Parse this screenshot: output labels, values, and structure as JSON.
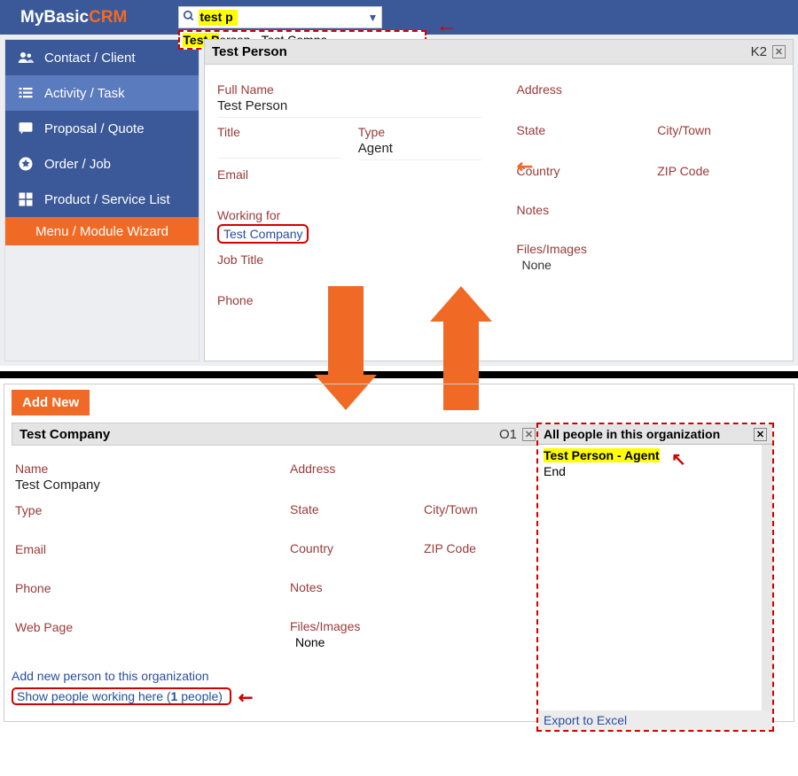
{
  "brand": {
    "part1": "MyBasic",
    "part2": "CRM"
  },
  "search": {
    "value": "test p",
    "suggestion_prefix": "Test P",
    "suggestion_rest": "erson - Test Compa"
  },
  "sidebar": {
    "items": [
      {
        "label": "Contact / Client"
      },
      {
        "label": "Activity / Task"
      },
      {
        "label": "Proposal / Quote"
      },
      {
        "label": "Order / Job"
      },
      {
        "label": "Product / Service List"
      }
    ],
    "wizard": "Menu / Module Wizard"
  },
  "person": {
    "header": "Test Person",
    "id": "K2",
    "labels": {
      "full_name": "Full Name",
      "title": "Title",
      "type": "Type",
      "email": "Email",
      "working_for": "Working for",
      "job_title": "Job Title",
      "phone": "Phone",
      "address": "Address",
      "state": "State",
      "city": "City/Town",
      "country": "Country",
      "zip": "ZIP Code",
      "notes": "Notes",
      "files": "Files/Images"
    },
    "full_name": "Test Person",
    "type": "Agent",
    "working_for": "Test Company",
    "files": "None"
  },
  "lower": {
    "add_new": "Add New"
  },
  "company": {
    "header": "Test Company",
    "id": "O1",
    "labels": {
      "name": "Name",
      "type": "Type",
      "email": "Email",
      "phone": "Phone",
      "web": "Web Page",
      "address": "Address",
      "state": "State",
      "city": "City/Town",
      "country": "Country",
      "zip": "ZIP Code",
      "notes": "Notes",
      "files": "Files/Images"
    },
    "name": "Test Company",
    "files": "None",
    "links": {
      "add_person": "Add new person to this organization",
      "show_people_pre": "Show people working here (",
      "show_people_count": "1",
      "show_people_suf": " people)"
    }
  },
  "popup": {
    "title": "All people in this organization",
    "item1": "Test Person - Agent",
    "end": "End",
    "export": "Export to Excel"
  }
}
